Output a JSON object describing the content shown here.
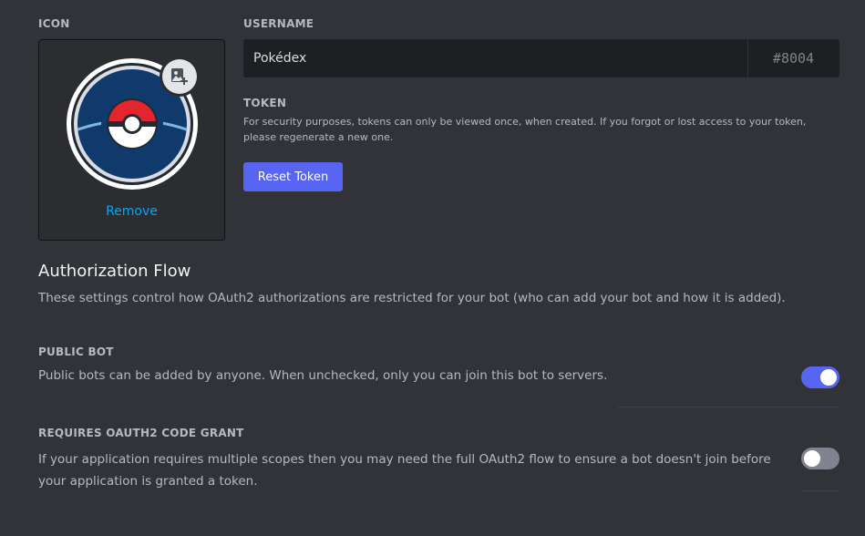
{
  "icon_section": {
    "label": "ICON",
    "remove_label": "Remove",
    "avatar_icon": "pokeball-icon",
    "upload_icon": "add-image-icon"
  },
  "username": {
    "label": "USERNAME",
    "value": "Pokédex",
    "discriminator": "#8004"
  },
  "token": {
    "label": "TOKEN",
    "description": "For security purposes, tokens can only be viewed once, when created. If you forgot or lost access to your token, please regenerate a new one.",
    "reset_button": "Reset Token"
  },
  "authorization_flow": {
    "title": "Authorization Flow",
    "description": "These settings control how OAuth2 authorizations are restricted for your bot (who can add your bot and how it is added)."
  },
  "public_bot": {
    "label": "PUBLIC BOT",
    "description": "Public bots can be added by anyone. When unchecked, only you can join this bot to servers.",
    "enabled": true
  },
  "oauth2_code_grant": {
    "label": "REQUIRES OAUTH2 CODE GRANT",
    "description": "If your application requires multiple scopes then you may need the full OAuth2 flow to ensure a bot doesn't join before your application is granted a token.",
    "enabled": false
  },
  "colors": {
    "background": "#313338",
    "accent": "#5865f2",
    "link": "#00a8fc",
    "toggle_off": "#80848e"
  }
}
